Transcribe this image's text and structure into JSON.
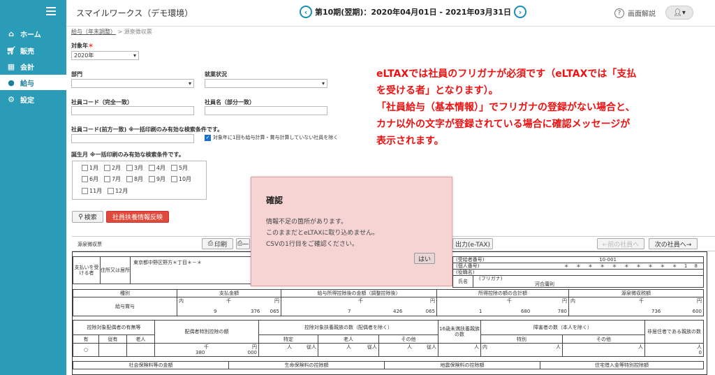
{
  "app": {
    "title": "スマイルワークス（デモ環境）",
    "period": "第10期(翌期)：2020年04月01日 - 2021年03月31日",
    "help_label": "画面解説"
  },
  "sidebar": {
    "items": [
      {
        "label": "ホーム",
        "icon": "home-icon"
      },
      {
        "label": "販売",
        "icon": "cart-icon"
      },
      {
        "label": "会計",
        "icon": "calculator-icon"
      },
      {
        "label": "給与",
        "icon": "money-bag-icon",
        "active": true
      },
      {
        "label": "設定",
        "icon": "gear-icon"
      }
    ]
  },
  "breadcrumb": {
    "parent": "給与（年末調整）",
    "current": "源泉徴収票"
  },
  "form": {
    "year_label": "対象年",
    "year_value": "2020年",
    "dept_label": "部門",
    "status_label": "就業状況",
    "empcode_label": "社員コード（完全一致）",
    "empname_label": "社員名（部分一致）",
    "empcode_prefix_label": "社員コード(前方一致) ※一括印刷のみ有効な検索条件です。",
    "exclude_label": "対象年に1回も給与計算・賞与計算していない社員を除く",
    "birth_label": "誕生月 ※一括印刷のみ有効な検索条件です。",
    "months": [
      "1月",
      "2月",
      "3月",
      "4月",
      "5月",
      "6月",
      "7月",
      "8月",
      "9月",
      "10月",
      "11月",
      "12月"
    ],
    "search_btn": "検索",
    "dependent_btn": "社員扶養情報反映"
  },
  "notice": {
    "line1": "eLTAXでは社員のフリガナが必須です（eLTAXでは「支払",
    "line2": "を受ける者」となります）。",
    "line3": "「社員給与（基本情報）」でフリガナの登録がない場合と、",
    "line4": "カナ以外の文字が登録されている場合に確認メッセージが",
    "line5": "表示されます。"
  },
  "docbar": {
    "tab": "源泉徴収票",
    "print_btn": "印刷",
    "print2_btn": "一",
    "etax_btn": "出力(e-TAX)",
    "prev_btn": "←前の社員へ",
    "next_btn": "次の社員へ→"
  },
  "doc": {
    "payee_label": "支払いを受ける者",
    "address_label": "住所又は居所",
    "address_value": "東京都中野区野方＊丁目＊－＊",
    "recipient_no_label": "(受給者番号)",
    "recipient_no": "10-001",
    "personal_no_label": "(個人番号)",
    "personal_no": "＊ ＊ ＊ ＊ ＊ ＊ ＊ ＊ ＊ ＊ 1 8",
    "position_label": "(役職名)",
    "name_label": "氏名",
    "furigana_label": "(フリガナ)",
    "name_value": "河合庸則",
    "h_type": "種別",
    "h_pay": "支払金額",
    "h_after": "給与所得控除後の金額（調整控除後）",
    "h_deduct": "所得控除の額の合計額",
    "h_tax": "源泉徴収税額",
    "type_value": "給与賞与",
    "inner": "内",
    "u_sen": "千",
    "u_en": "円",
    "pay_a": "9",
    "pay_b": "376",
    "pay_c": "065",
    "after_a": "7",
    "after_b": "426",
    "after_c": "065",
    "ded_a": "1",
    "ded_b": "680",
    "ded_c": "780",
    "tax_b": "736",
    "tax_c": "600",
    "h_spouse": "控除対象配偶者の有無等",
    "h_spouse_sp": "配偶者特別控除の額",
    "h_dep": "控除対象扶養親族の数（配偶者を除く）",
    "h_under16": "16歳未満扶養親族の数",
    "h_disabled": "障害者の数（本人を除く）",
    "h_nonres": "非居住者である親族の数",
    "h_yes": "有",
    "h_sub": "従有",
    "h_old": "老人",
    "h_special": "特定",
    "h_old2": "老人",
    "h_other": "その他",
    "h_special2": "特別",
    "h_other2": "その他",
    "u_nin": "人",
    "u_jyu": "従人",
    "circle": "○",
    "sp_a": "380",
    "sp_b": "000",
    "nonres_value": "0",
    "f_social": "社会保険料等の金額",
    "f_life": "生命保険料の控除額",
    "f_quake": "地震保険料の控除額",
    "f_loan": "住宅借入金等特別控除額"
  },
  "modal": {
    "title": "確認",
    "line1": "情報不足の箇所があります。",
    "line2": "このままだとeLTAXに取り込めません。",
    "line3": "CSVの1行目をご確認ください。",
    "ok": "はい"
  }
}
